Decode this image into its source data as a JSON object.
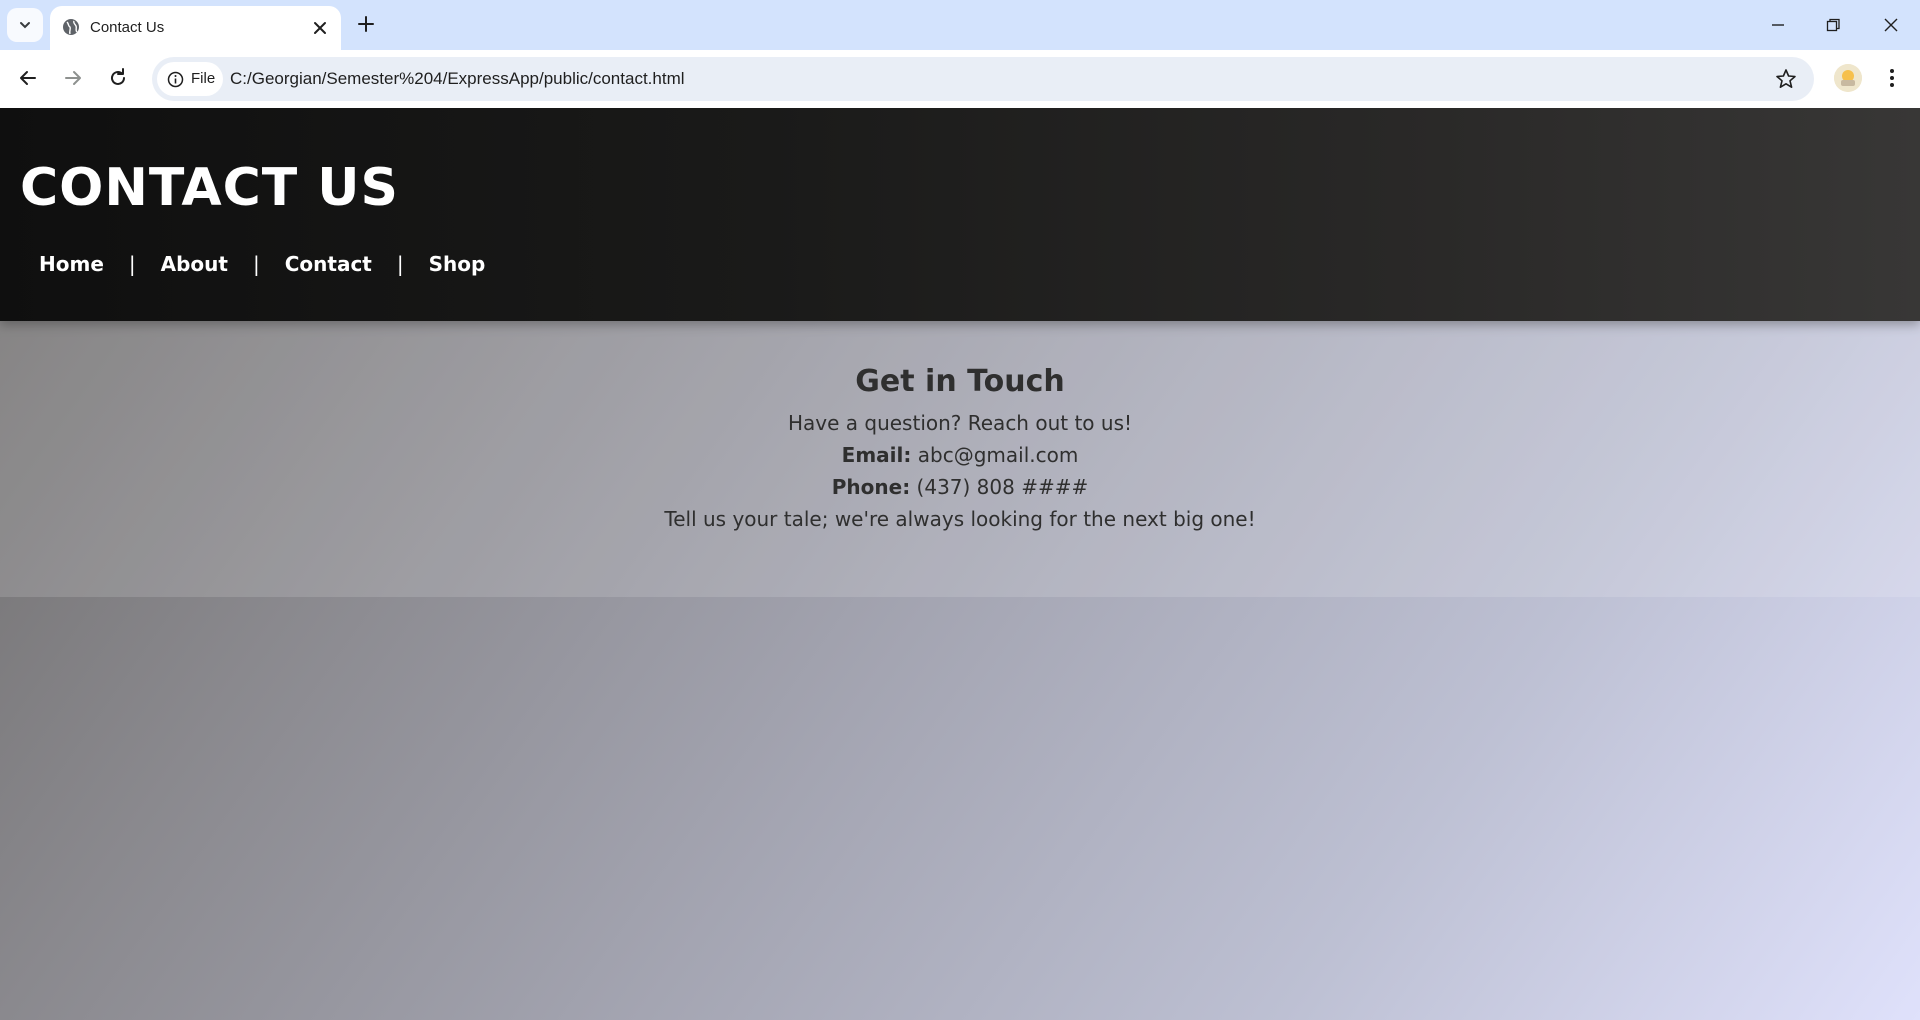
{
  "browser": {
    "tab_title": "Contact Us",
    "security_chip_label": "File",
    "url": "C:/Georgian/Semester%204/ExpressApp/public/contact.html",
    "icons": [
      "tab-search-icon",
      "globe-icon",
      "close-icon",
      "plus-icon",
      "minimize-icon",
      "restore-icon",
      "window-close-icon",
      "back-icon",
      "forward-icon",
      "reload-icon",
      "info-icon",
      "star-icon",
      "profile-avatar",
      "more-vert-icon"
    ]
  },
  "site": {
    "title": "CONTACT US",
    "nav": [
      {
        "label": "Home"
      },
      {
        "label": "About"
      },
      {
        "label": "Contact"
      },
      {
        "label": "Shop"
      }
    ],
    "nav_separator": "|"
  },
  "contact": {
    "heading": "Get in Touch",
    "intro": "Have a question? Reach out to us!",
    "email_label": "Email:",
    "email_value": "abc@gmail.com",
    "phone_label": "Phone:",
    "phone_value": "(437) 808 ####",
    "tagline": "Tell us your tale; we're always looking for the next big one!"
  },
  "colors": {
    "header_bg": "#111111",
    "tabstrip_bg": "#d3e3fd",
    "text_dark": "#2f2f2f",
    "text_light": "#ffffff"
  }
}
